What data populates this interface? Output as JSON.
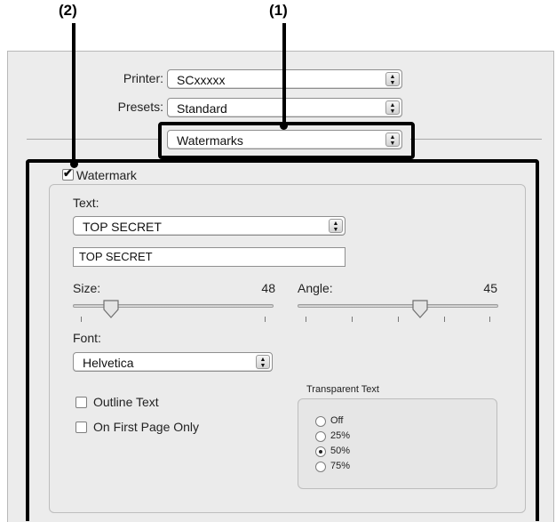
{
  "callouts": {
    "one": "(1)",
    "two": "(2)"
  },
  "printer": {
    "label": "Printer:",
    "value": "SCxxxxx"
  },
  "presets": {
    "label": "Presets:",
    "value": "Standard"
  },
  "panel": {
    "value": "Watermarks"
  },
  "watermark": {
    "checkbox_label": "Watermark",
    "checked": true,
    "text_label": "Text:",
    "text_popup": "TOP SECRET",
    "text_field": "TOP SECRET",
    "size_label": "Size:",
    "size_value": "48",
    "angle_label": "Angle:",
    "angle_value": "45",
    "size_slider_fraction": 0.16,
    "angle_slider_fraction": 0.62,
    "font_label": "Font:",
    "font_value": "Helvetica",
    "outline_label": "Outline Text",
    "first_page_label": "On First Page Only",
    "transparent": {
      "title": "Transparent Text",
      "options": [
        "Off",
        "25%",
        "50%",
        "75%"
      ],
      "selected": "50%"
    }
  },
  "icons": {
    "popup": "up-down-arrows-icon",
    "check": "checkmark-icon"
  }
}
